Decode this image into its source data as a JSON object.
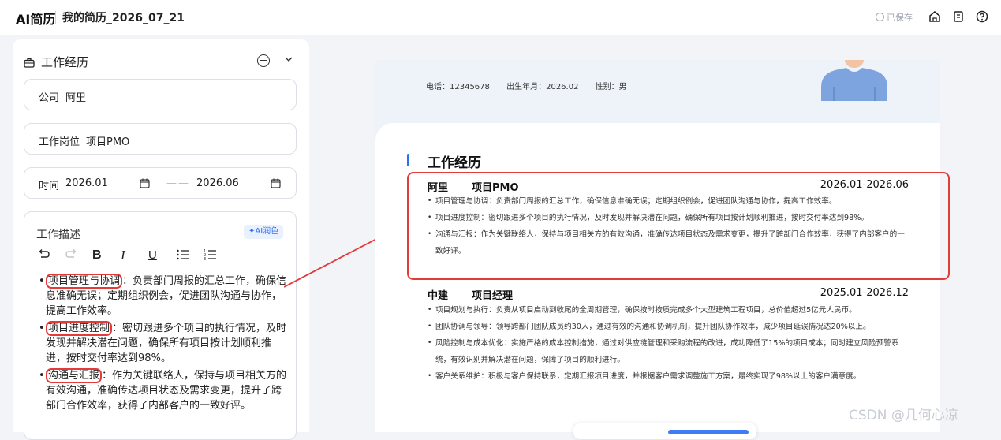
{
  "header": {
    "logo": "AI简历",
    "doc_title": "我的简历_2026_07_21",
    "saved_label": "已保存"
  },
  "editor": {
    "section_title": "工作经历",
    "company": {
      "label": "公司",
      "value": "阿里"
    },
    "position": {
      "label": "工作岗位",
      "value": "项目PMO"
    },
    "time": {
      "label": "时间",
      "start": "2026.01",
      "end": "2026.06",
      "separator": "——"
    },
    "description": {
      "label": "工作描述",
      "ai_button": "✦AI润色",
      "toolbar": [
        "undo-icon",
        "redo-icon",
        "bold-icon",
        "italic-icon",
        "underline-icon",
        "bullet-list-icon",
        "numbered-list-icon"
      ],
      "items": [
        {
          "key": "项目管理与协调",
          "text": "：负责部门周报的汇总工作，确保信息准确无误；定期组织例会，促进团队沟通与协作，提高工作效率。"
        },
        {
          "key": "项目进度控制",
          "text": "：密切跟进多个项目的执行情况，及时发现并解决潜在问题，确保所有项目按计划顺利推进，按时交付率达到98%。"
        },
        {
          "key": "沟通与汇报",
          "text": "：作为关键联络人，保持与项目相关方的有效沟通，准确传达项目状态及需求变更，提升了跨部门合作效率，获得了内部客户的一致好评。"
        }
      ]
    }
  },
  "preview": {
    "contact": {
      "phone": "电话：12345678",
      "birth": "出生年月：2026.02",
      "gender": "性别：男"
    },
    "section_title": "工作经历",
    "jobs": [
      {
        "company": "阿里",
        "position": "项目PMO",
        "date": "2026.01-2026.06",
        "bullets": [
          "项目管理与协调：负责部门周报的汇总工作，确保信息准确无误；定期组织例会，促进团队沟通与协作，提高工作效率。",
          "项目进度控制：密切跟进多个项目的执行情况，及时发现并解决潜在问题，确保所有项目按计划顺利推进，按时交付率达到98%。",
          "沟通与汇报：作为关键联络人，保持与项目相关方的有效沟通，准确传达项目状态及需求变更，提升了跨部门合作效率，获得了内部客户的一致好评。"
        ]
      },
      {
        "company": "中建",
        "position": "项目经理",
        "date": "2025.01-2026.12",
        "bullets": [
          "项目规划与执行：负责从项目启动到收尾的全周期管理，确保按时按质完成多个大型建筑工程项目，总价值超过5亿元人民币。",
          "团队协调与领导：领导跨部门团队成员约30人，通过有效的沟通和协调机制，提升团队协作效率，减少项目延误情况达20%以上。",
          "风险控制与成本优化：实施严格的成本控制措施，通过对供应链管理和采购流程的改进，成功降低了15%的项目成本；同时建立风险预警系统，有效识别并解决潜在问题，保障了项目的顺利进行。",
          "客户关系维护：积极与客户保持联系，定期汇报项目进度，并根据客户需求调整施工方案，最终实现了98%以上的客户满意度。"
        ]
      }
    ]
  },
  "watermark": "CSDN @几何心凉",
  "colors": {
    "accent": "#2d6ff0",
    "annotation": "#e53a3a"
  }
}
